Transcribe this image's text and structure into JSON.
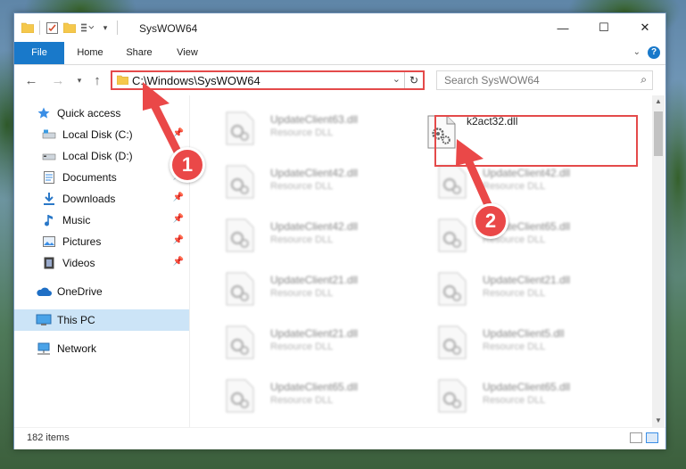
{
  "window": {
    "title": "SysWOW64",
    "controls": {
      "minimize": "—",
      "maximize": "☐",
      "close": "✕"
    }
  },
  "ribbon": {
    "tabs": [
      "File",
      "Home",
      "Share",
      "View"
    ],
    "help": "?"
  },
  "nav": {
    "address": "C:\\Windows\\SysWOW64",
    "search_placeholder": "Search SysWOW64"
  },
  "sidebar": {
    "items": [
      {
        "label": "Quick access",
        "icon": "star-icon"
      },
      {
        "label": "Local Disk (C:)",
        "icon": "drive-icon"
      },
      {
        "label": "Local Disk (D:)",
        "icon": "drive-icon"
      },
      {
        "label": "Documents",
        "icon": "documents-icon"
      },
      {
        "label": "Downloads",
        "icon": "download-icon"
      },
      {
        "label": "Music",
        "icon": "music-icon"
      },
      {
        "label": "Pictures",
        "icon": "pictures-icon"
      },
      {
        "label": "Videos",
        "icon": "videos-icon"
      },
      {
        "label": "OneDrive",
        "icon": "cloud-icon"
      },
      {
        "label": "This PC",
        "icon": "computer-icon"
      },
      {
        "label": "Network",
        "icon": "network-icon"
      }
    ]
  },
  "files": {
    "left": [
      {
        "name": "UpdateClient63.dll",
        "type": "Resource DLL"
      },
      {
        "name": "UpdateClient42.dll",
        "type": "Resource DLL"
      },
      {
        "name": "UpdateClient42.dll",
        "type": "Resource DLL"
      },
      {
        "name": "UpdateClient21.dll",
        "type": "Resource DLL"
      },
      {
        "name": "UpdateClient21.dll",
        "type": "Resource DLL"
      },
      {
        "name": "UpdateClient65.dll",
        "type": "Resource DLL"
      }
    ],
    "right": [
      {
        "name": "k2act32.dll",
        "type": ""
      },
      {
        "name": "UpdateClient42.dll",
        "type": "Resource DLL"
      },
      {
        "name": "UpdateClient65.dll",
        "type": "Resource DLL"
      },
      {
        "name": "UpdateClient21.dll",
        "type": "Resource DLL"
      },
      {
        "name": "UpdateClient5.dll",
        "type": "Resource DLL"
      },
      {
        "name": "UpdateClient65.dll",
        "type": "Resource DLL"
      }
    ]
  },
  "status": {
    "item_count": "182 items"
  },
  "annotations": {
    "step1": "1",
    "step2": "2",
    "color": "#ea4848"
  }
}
